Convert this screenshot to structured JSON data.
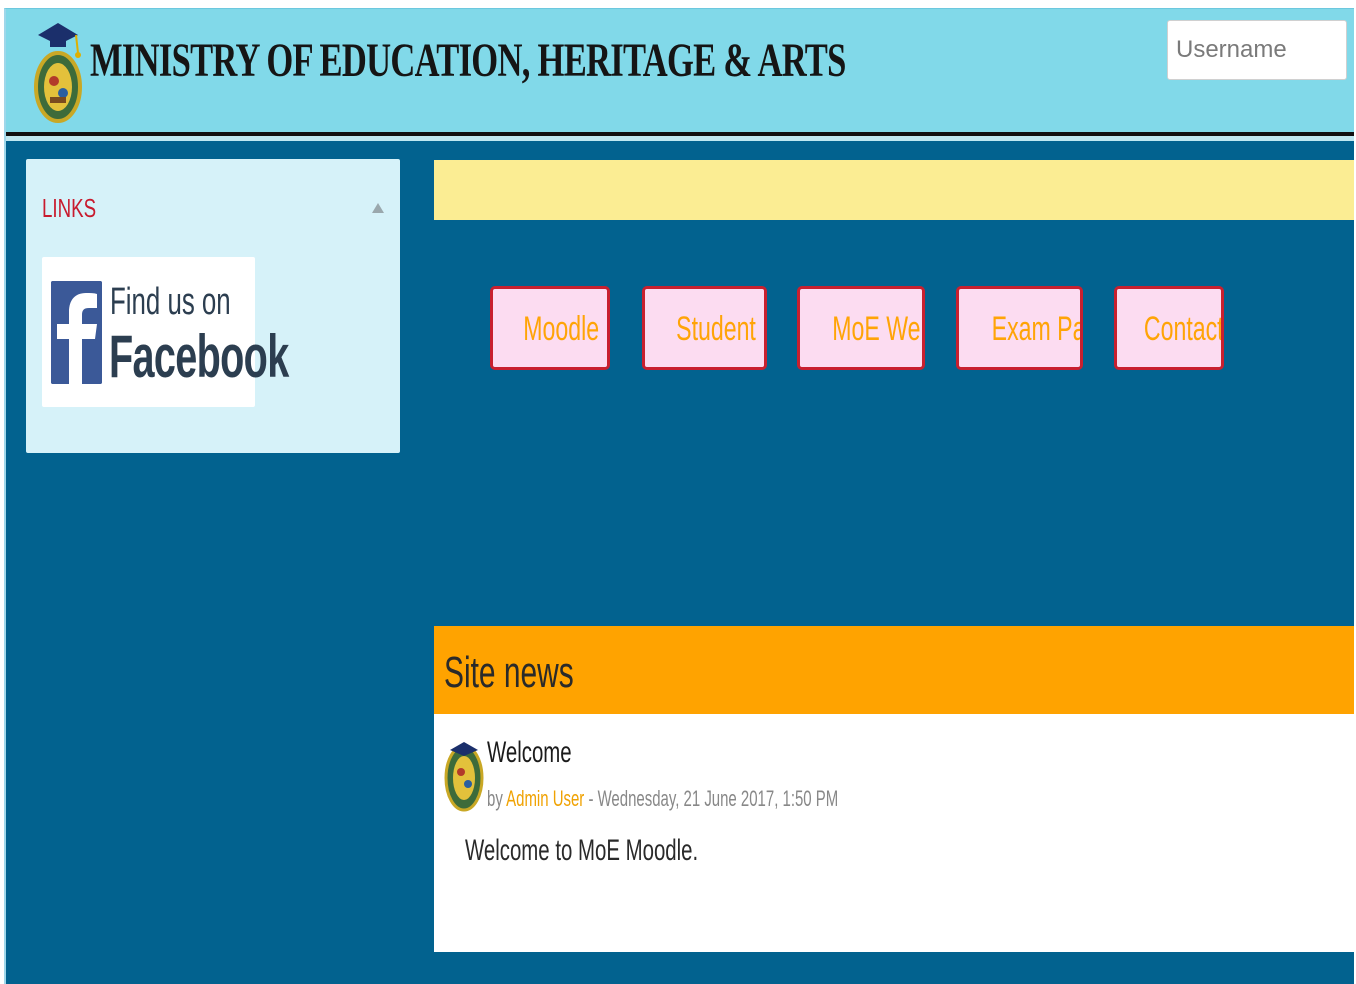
{
  "header": {
    "title": "MINISTRY OF EDUCATION, HERITAGE & ARTS",
    "logo_icon": "ministry-crest-icon",
    "username_placeholder": "Username"
  },
  "links_block": {
    "title": "LINKS",
    "collapse_icon": "caret-up-icon",
    "facebook": {
      "line1": "Find us on",
      "line2": "Facebook"
    }
  },
  "announcement_bar": {
    "color": "#fbed93"
  },
  "nav_buttons": [
    {
      "label": "Moodle FAQ"
    },
    {
      "label": "Student FAQ"
    },
    {
      "label": "MoE Website"
    },
    {
      "label": "Exam Papers"
    },
    {
      "label": "Contact Us"
    }
  ],
  "site_news": {
    "title": "Site news",
    "posts": [
      {
        "subject": "Welcome",
        "by_prefix": "by",
        "author": "Admin User",
        "date": " - Wednesday, 21 June 2017, 1:50 PM",
        "content": "Welcome to MoE Moodle."
      }
    ]
  },
  "colors": {
    "header_bg": "#81d9e9",
    "page_bg": "#02628f",
    "button_bg": "#fcdcf1",
    "button_border": "#c8202f",
    "button_text": "#ffa407",
    "news_header": "#ffa300",
    "links_title": "#c81b2e"
  }
}
